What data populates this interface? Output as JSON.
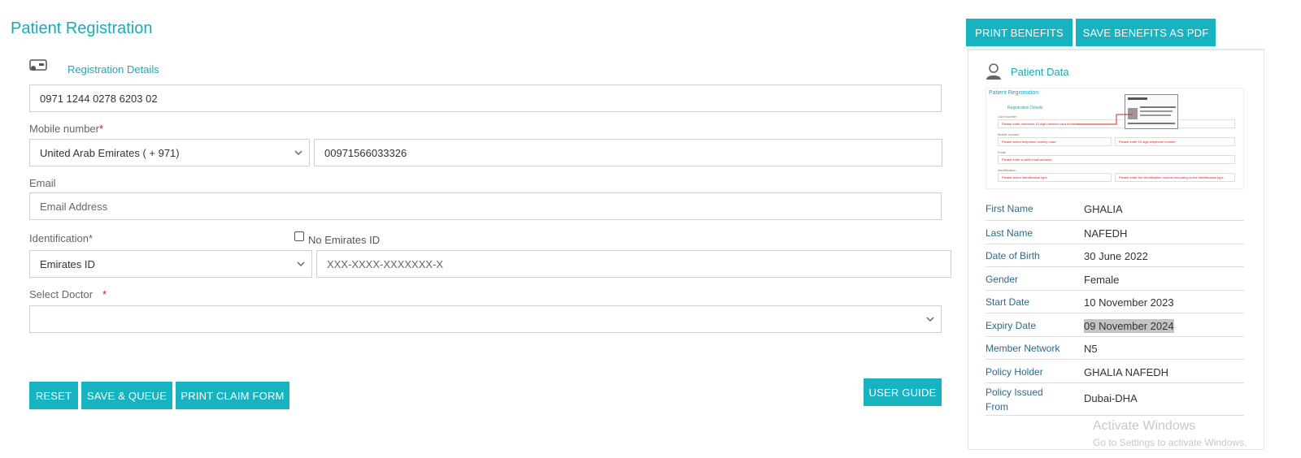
{
  "page": {
    "title": "Patient Registration",
    "section_heading": "Registration Details"
  },
  "form": {
    "card_number_value": "0971 1244 0278 6203 02",
    "mobile_label": "Mobile number",
    "required_mark": "*",
    "country_code_selected": "United Arab Emirates ( + 971)",
    "mobile_value": "00971566033326",
    "email_label": "Email",
    "email_placeholder": "Email Address",
    "identification_label": "Identification*",
    "no_emirates_id_label": "No Emirates ID",
    "no_emirates_id_checked": false,
    "id_type_selected": "Emirates ID",
    "id_number_placeholder": "XXX-XXXX-XXXXXXX-X",
    "doctor_label": "Select Doctor",
    "doctor_selected": ""
  },
  "buttons": {
    "reset": "RESET",
    "save_queue": "SAVE & QUEUE",
    "print_claim": "PRINT CLAIM FORM",
    "user_guide": "USER GUIDE",
    "print_benefits": "PRINT BENEFITS",
    "save_benefits_pdf": "SAVE BENEFITS AS PDF"
  },
  "patient_data": {
    "heading": "Patient Data",
    "thumbnail": {
      "title": "Patient Registration",
      "sub": "Registration Details",
      "lab1": "Card number",
      "err1": "Please enter members 10 digit member card number",
      "lab2": "Mobile number",
      "err2a": "Please select telephone country code",
      "err2b": "Please enter 10 digit telephone number",
      "lab3": "Email",
      "err3": "Please enter a valid email address",
      "lab4": "Identification",
      "err4a": "Please select identification type",
      "err4b": "Please enter the identification number according to the identification type"
    },
    "rows": [
      {
        "key": "First Name",
        "value": "GHALIA"
      },
      {
        "key": "Last Name",
        "value": "NAFEDH"
      },
      {
        "key": "Date of Birth",
        "value": "30 June 2022"
      },
      {
        "key": "Gender",
        "value": "Female"
      },
      {
        "key": "Start Date",
        "value": "10 November 2023"
      },
      {
        "key": "Expiry Date",
        "value": "09 November 2024"
      },
      {
        "key": "Member Network",
        "value": "N5"
      },
      {
        "key": "Policy Holder",
        "value": "GHALIA NAFEDH"
      },
      {
        "key": "Policy Issued From",
        "value": "Dubai-DHA"
      }
    ]
  },
  "watermark": {
    "line1": "Activate Windows",
    "line2": "Go to Settings to activate Windows."
  },
  "colors": {
    "accent": "#17b3c1",
    "heading": "#1ba9b9",
    "required": "#e0162b",
    "key_text": "#2b6a8d"
  },
  "icons": {
    "registration": "id-card-icon",
    "patient": "user-icon",
    "dropdown": "chevron-down-icon"
  }
}
